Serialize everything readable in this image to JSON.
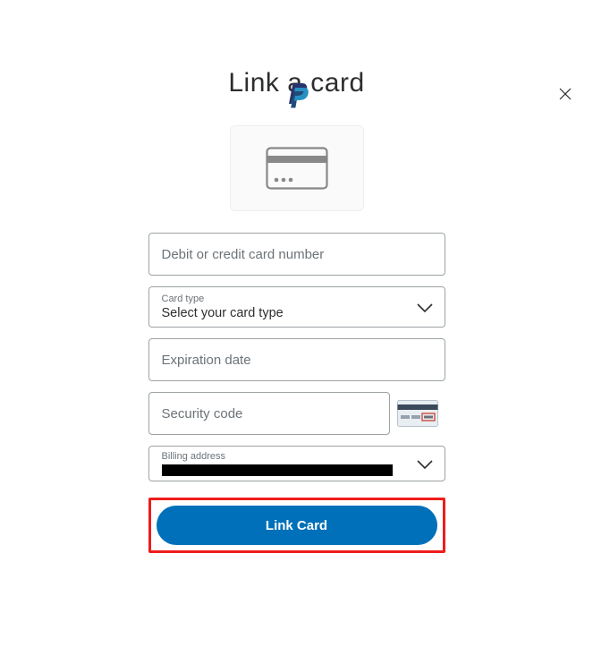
{
  "header": {
    "title": "Link a card"
  },
  "form": {
    "cardNumber": {
      "placeholder": "Debit or credit card number"
    },
    "cardType": {
      "label": "Card type",
      "selected": "Select your card type"
    },
    "expiration": {
      "placeholder": "Expiration date"
    },
    "securityCode": {
      "placeholder": "Security code"
    },
    "billing": {
      "label": "Billing address"
    },
    "submitLabel": "Link Card"
  }
}
